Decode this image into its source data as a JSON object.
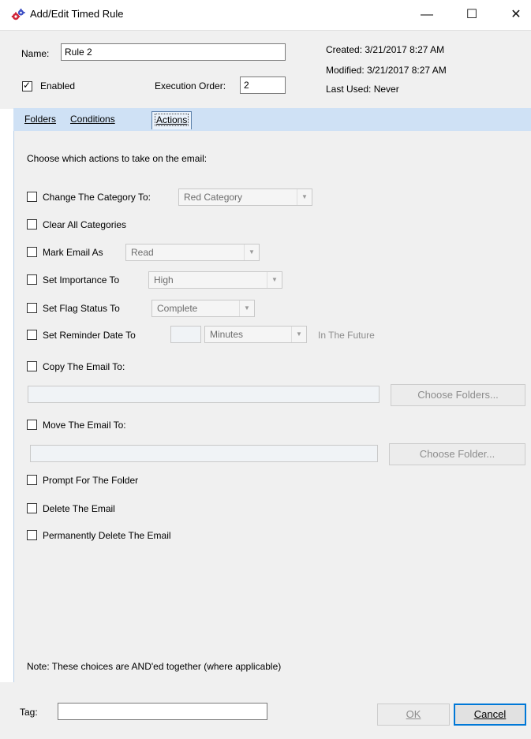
{
  "window": {
    "title": "Add/Edit Timed Rule",
    "minimize_glyph": "—",
    "maximize_glyph": "☐",
    "close_glyph": "✕"
  },
  "header": {
    "name_label": "Name:",
    "name_value": "Rule 2",
    "enabled_label": "Enabled",
    "enabled_checked": true,
    "execution_order_label": "Execution Order:",
    "execution_order_value": "2",
    "created": "Created: 3/21/2017 8:27 AM",
    "modified": "Modified: 3/21/2017 8:27 AM",
    "last_used": "Last Used: Never"
  },
  "tabs": [
    {
      "label": "Folders",
      "active": false
    },
    {
      "label": "Conditions",
      "active": false
    },
    {
      "label": "Actions",
      "active": true
    }
  ],
  "actions": {
    "intro": "Choose which actions to take on the email:",
    "change_category": {
      "label": "Change The Category To:",
      "value": "Red Category"
    },
    "clear_categories": {
      "label": "Clear All Categories"
    },
    "mark_email": {
      "label": "Mark Email As",
      "value": "Read"
    },
    "set_importance": {
      "label": "Set Importance To",
      "value": "High"
    },
    "set_flag": {
      "label": "Set Flag Status To",
      "value": "Complete"
    },
    "set_reminder": {
      "label": "Set Reminder Date To",
      "amount": "",
      "unit": "Minutes",
      "suffix": "In The Future"
    },
    "copy_email": {
      "label": "Copy The Email To:",
      "path": "",
      "button": "Choose Folders..."
    },
    "move_email": {
      "label": "Move The Email To:",
      "path": "",
      "button": "Choose Folder..."
    },
    "prompt_folder": {
      "label": "Prompt For The Folder"
    },
    "delete_email": {
      "label": "Delete The Email"
    },
    "perm_delete": {
      "label": "Permanently Delete The Email"
    },
    "note": "Note: These choices are AND'ed together (where applicable)"
  },
  "footer": {
    "tag_label": "Tag:",
    "tag_value": "",
    "ok_label": "OK",
    "cancel_label": "Cancel"
  },
  "icons": {
    "app": "gears-icon"
  },
  "colors": {
    "tab_strip": "#cfe1f5",
    "panel_bg": "#f0f0f0",
    "accent": "#0078d7"
  }
}
